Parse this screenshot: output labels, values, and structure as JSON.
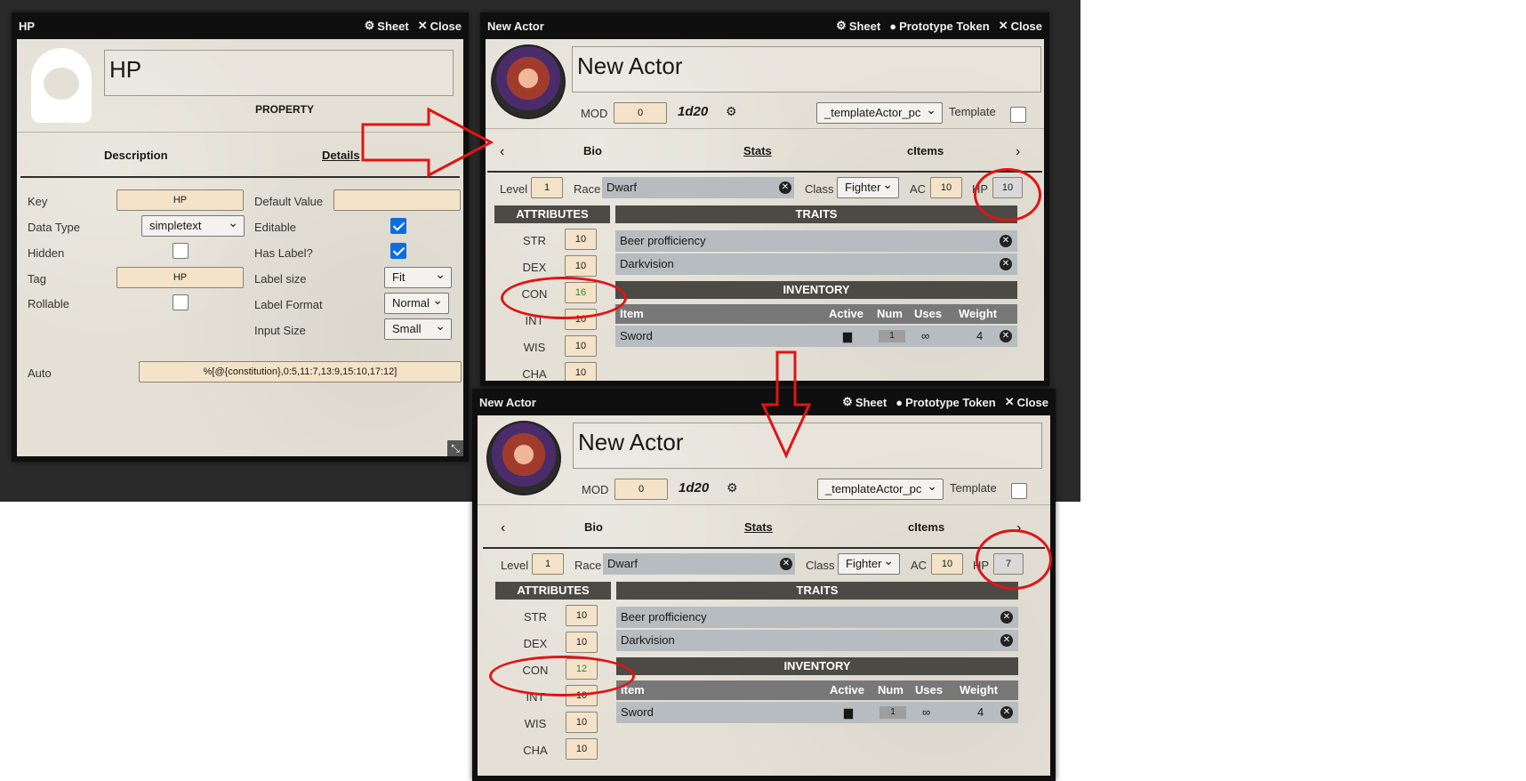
{
  "hp_window": {
    "title": "HP",
    "sheet_label": "Sheet",
    "close_label": "Close",
    "name": "HP",
    "type_label": "PROPERTY",
    "tabs": [
      "Description",
      "Details"
    ],
    "fields": {
      "key_label": "Key",
      "key_value": "HP",
      "default_value_label": "Default Value",
      "default_value": "",
      "data_type_label": "Data Type",
      "data_type_value": "simpletext",
      "editable_label": "Editable",
      "hidden_label": "Hidden",
      "has_label_label": "Has Label?",
      "tag_label": "Tag",
      "tag_value": "HP",
      "label_size_label": "Label size",
      "label_size_value": "Fit",
      "rollable_label": "Rollable",
      "label_format_label": "Label Format",
      "label_format_value": "Normal",
      "input_size_label": "Input Size",
      "input_size_value": "Small",
      "auto_label": "Auto",
      "auto_value": "%[@{constitution},0:5,11:7,13:9,15:10,17:12]"
    },
    "checkboxes": {
      "editable": true,
      "hidden": false,
      "has_label": true,
      "rollable": false
    }
  },
  "actor_windows": [
    {
      "title": "New Actor",
      "sheet_label": "Sheet",
      "token_label": "Prototype Token",
      "close_label": "Close",
      "name": "New Actor",
      "mod_label": "MOD",
      "mod_value": "0",
      "dice_label": "1d20",
      "template_select": "_templateActor_pc",
      "template_label": "Template",
      "tabs": [
        "Bio",
        "Stats",
        "cItems"
      ],
      "level_label": "Level",
      "level_value": "1",
      "race_label": "Race",
      "race_value": "Dwarf",
      "class_label": "Class",
      "class_value": "Fighter",
      "ac_label": "AC",
      "ac_value": "10",
      "hp_label": "HP",
      "hp_value": "10",
      "attributes_title": "ATTRIBUTES",
      "attributes": [
        {
          "label": "STR",
          "value": "10"
        },
        {
          "label": "DEX",
          "value": "10"
        },
        {
          "label": "CON",
          "value": "16"
        },
        {
          "label": "INT",
          "value": "10"
        },
        {
          "label": "WIS",
          "value": "10"
        },
        {
          "label": "CHA",
          "value": "10"
        }
      ],
      "traits_title": "TRAITS",
      "traits": [
        "Beer profficiency",
        "Darkvision"
      ],
      "inventory_title": "INVENTORY",
      "inventory_headers": [
        "Item",
        "Active",
        "Num",
        "Uses",
        "Weight"
      ],
      "inventory_rows": [
        {
          "item": "Sword",
          "num": "1",
          "uses": "∞",
          "weight": "4"
        }
      ]
    },
    {
      "title": "New Actor",
      "sheet_label": "Sheet",
      "token_label": "Prototype Token",
      "close_label": "Close",
      "name": "New Actor",
      "mod_label": "MOD",
      "mod_value": "0",
      "dice_label": "1d20",
      "template_select": "_templateActor_pc",
      "template_label": "Template",
      "tabs": [
        "Bio",
        "Stats",
        "cItems"
      ],
      "level_label": "Level",
      "level_value": "1",
      "race_label": "Race",
      "race_value": "Dwarf",
      "class_label": "Class",
      "class_value": "Fighter",
      "ac_label": "AC",
      "ac_value": "10",
      "hp_label": "HP",
      "hp_value": "7",
      "attributes_title": "ATTRIBUTES",
      "attributes": [
        {
          "label": "STR",
          "value": "10"
        },
        {
          "label": "DEX",
          "value": "10"
        },
        {
          "label": "CON",
          "value": "12"
        },
        {
          "label": "INT",
          "value": "10"
        },
        {
          "label": "WIS",
          "value": "10"
        },
        {
          "label": "CHA",
          "value": "10"
        }
      ],
      "traits_title": "TRAITS",
      "traits": [
        "Beer profficiency",
        "Darkvision"
      ],
      "inventory_title": "INVENTORY",
      "inventory_headers": [
        "Item",
        "Active",
        "Num",
        "Uses",
        "Weight"
      ],
      "inventory_rows": [
        {
          "item": "Sword",
          "num": "1",
          "uses": "∞",
          "weight": "4"
        }
      ]
    }
  ],
  "colors": {
    "annotation": "#e01414",
    "parchment": "#e4e0d6",
    "field": "#f4e3c9",
    "section_header": "#4b4a44"
  },
  "icons": [
    "gear-icon",
    "close-icon",
    "user-circle-icon",
    "dice-icon",
    "remove-icon",
    "book-icon",
    "resize-icon",
    "hood-icon"
  ]
}
